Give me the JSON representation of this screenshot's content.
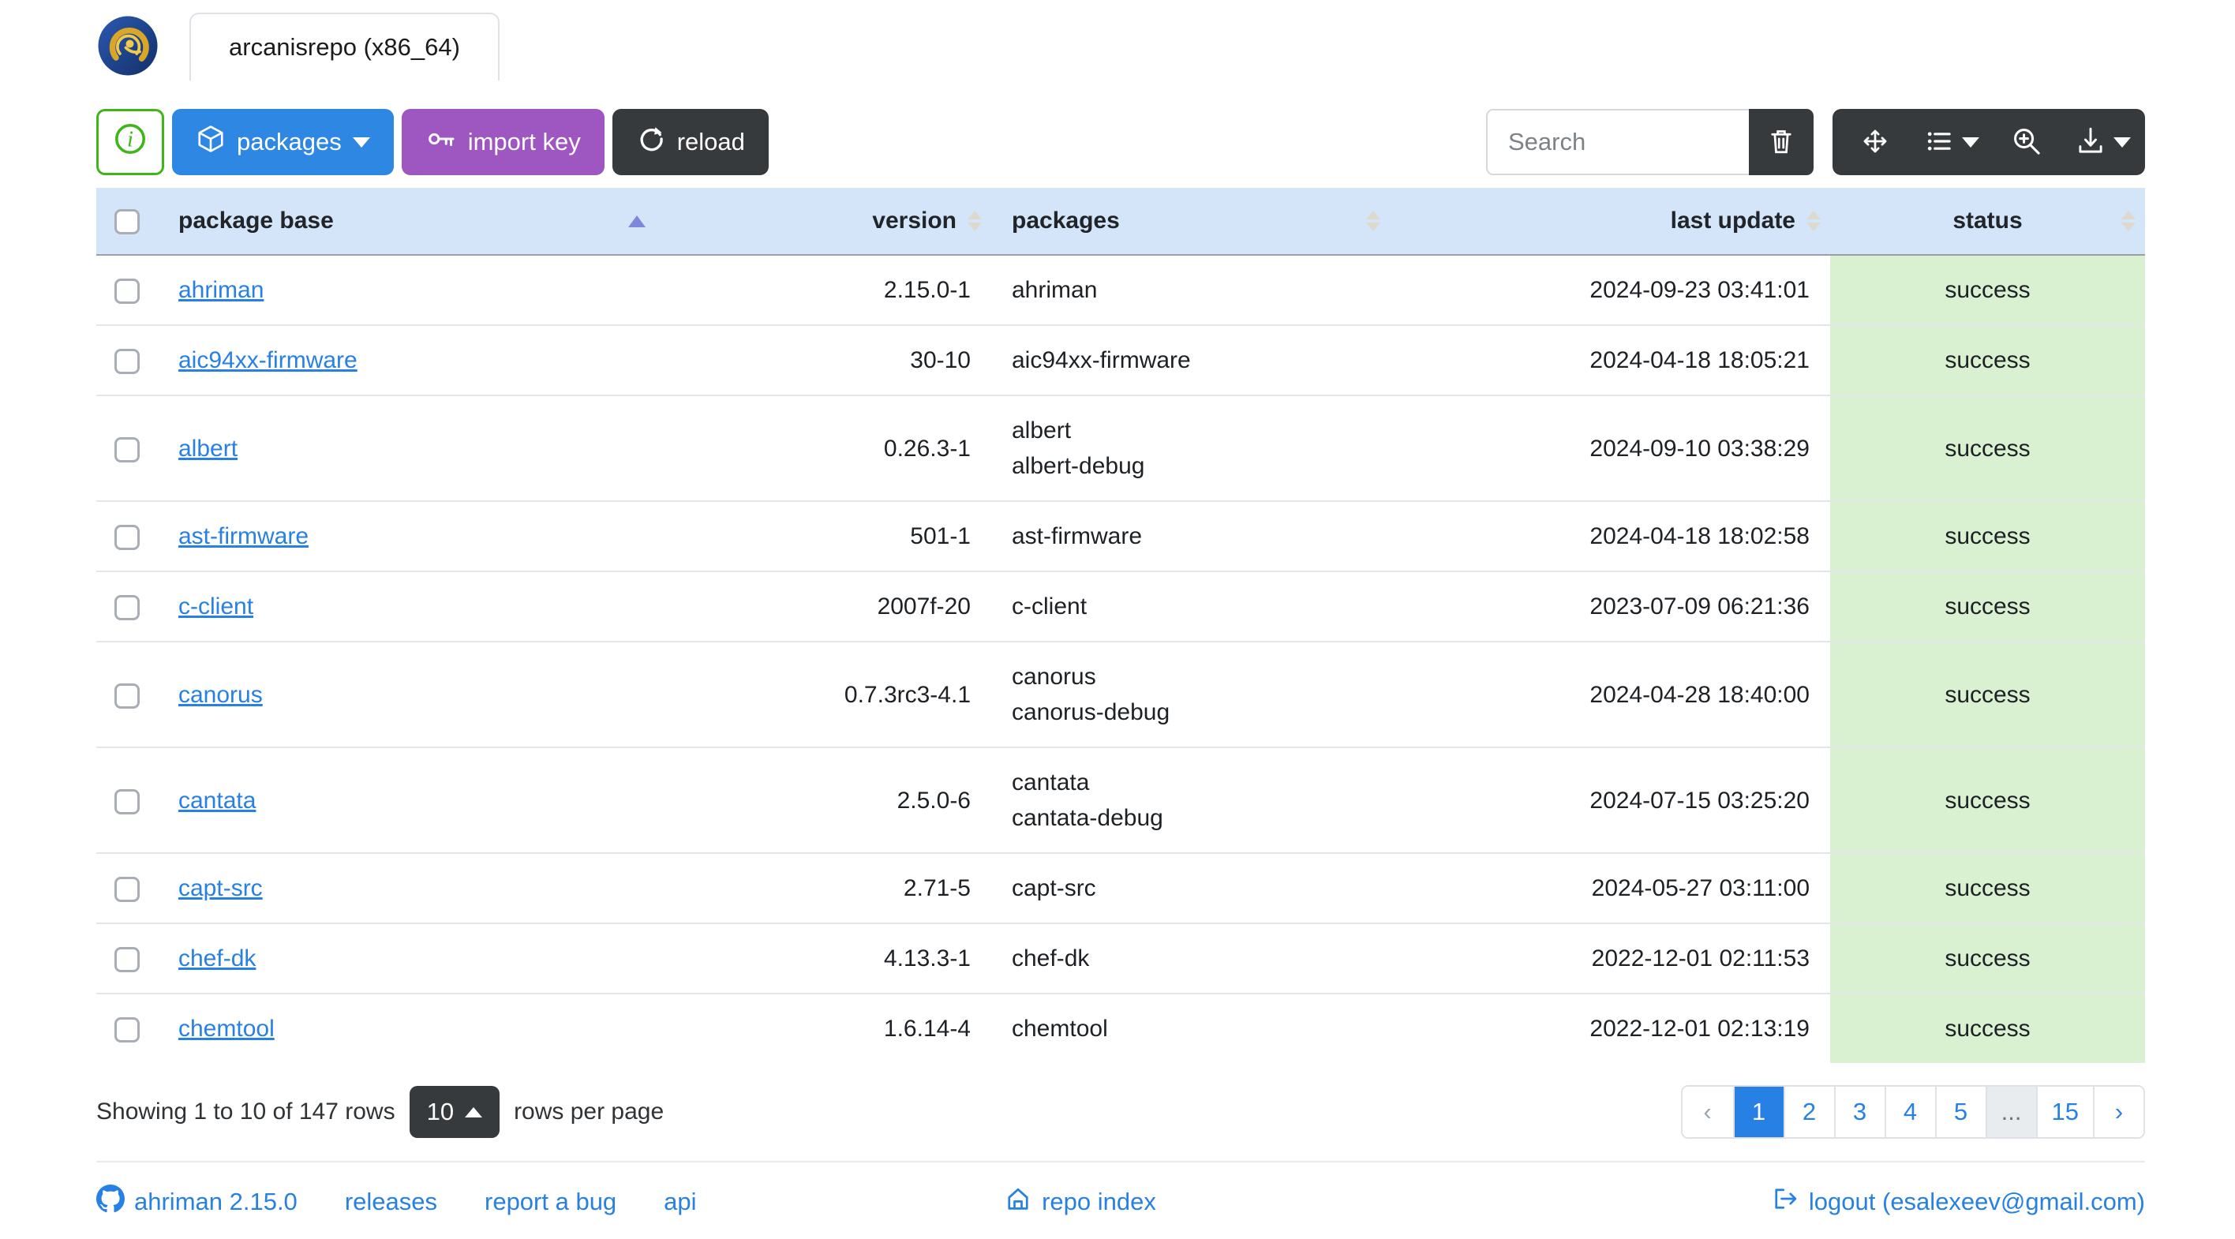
{
  "header": {
    "tab_title": "arcanisrepo (x86_64)"
  },
  "toolbar": {
    "packages_label": "packages",
    "import_key_label": "import key",
    "reload_label": "reload",
    "search_placeholder": "Search"
  },
  "table": {
    "columns": [
      "package base",
      "version",
      "packages",
      "last update",
      "status"
    ],
    "sort": {
      "column": "package base",
      "direction": "asc"
    },
    "rows": [
      {
        "base": "ahriman",
        "version": "2.15.0-1",
        "packages": [
          "ahriman"
        ],
        "last_update": "2024-09-23 03:41:01",
        "status": "success"
      },
      {
        "base": "aic94xx-firmware",
        "version": "30-10",
        "packages": [
          "aic94xx-firmware"
        ],
        "last_update": "2024-04-18 18:05:21",
        "status": "success"
      },
      {
        "base": "albert",
        "version": "0.26.3-1",
        "packages": [
          "albert",
          "albert-debug"
        ],
        "last_update": "2024-09-10 03:38:29",
        "status": "success"
      },
      {
        "base": "ast-firmware",
        "version": "501-1",
        "packages": [
          "ast-firmware"
        ],
        "last_update": "2024-04-18 18:02:58",
        "status": "success"
      },
      {
        "base": "c-client",
        "version": "2007f-20",
        "packages": [
          "c-client"
        ],
        "last_update": "2023-07-09 06:21:36",
        "status": "success"
      },
      {
        "base": "canorus",
        "version": "0.7.3rc3-4.1",
        "packages": [
          "canorus",
          "canorus-debug"
        ],
        "last_update": "2024-04-28 18:40:00",
        "status": "success"
      },
      {
        "base": "cantata",
        "version": "2.5.0-6",
        "packages": [
          "cantata",
          "cantata-debug"
        ],
        "last_update": "2024-07-15 03:25:20",
        "status": "success"
      },
      {
        "base": "capt-src",
        "version": "2.71-5",
        "packages": [
          "capt-src"
        ],
        "last_update": "2024-05-27 03:11:00",
        "status": "success"
      },
      {
        "base": "chef-dk",
        "version": "4.13.3-1",
        "packages": [
          "chef-dk"
        ],
        "last_update": "2022-12-01 02:11:53",
        "status": "success"
      },
      {
        "base": "chemtool",
        "version": "1.6.14-4",
        "packages": [
          "chemtool"
        ],
        "last_update": "2022-12-01 02:13:19",
        "status": "success"
      }
    ]
  },
  "pagination": {
    "summary": "Showing 1 to 10 of 147 rows",
    "page_size": "10",
    "rows_per_page_label": "rows per page",
    "items": [
      {
        "label": "‹",
        "state": "disabled"
      },
      {
        "label": "1",
        "state": "active"
      },
      {
        "label": "2",
        "state": ""
      },
      {
        "label": "3",
        "state": ""
      },
      {
        "label": "4",
        "state": ""
      },
      {
        "label": "5",
        "state": ""
      },
      {
        "label": "...",
        "state": "ellipsis"
      },
      {
        "label": "15",
        "state": ""
      },
      {
        "label": "›",
        "state": ""
      }
    ]
  },
  "footer": {
    "version_link": "ahriman 2.15.0",
    "releases_link": "releases",
    "report_bug_link": "report a bug",
    "api_link": "api",
    "repo_index_link": "repo index",
    "logout_link": "logout (esalexeev@gmail.com)"
  },
  "colors": {
    "primary_blue": "#2780e3",
    "info_purple": "#9954bb",
    "dark": "#373a3c",
    "success_green": "#3fb618",
    "table_header_bg": "#d4e5f9",
    "status_cell_bg": "#d9f0d1",
    "sort_arrow_active": "#7d87dc"
  }
}
